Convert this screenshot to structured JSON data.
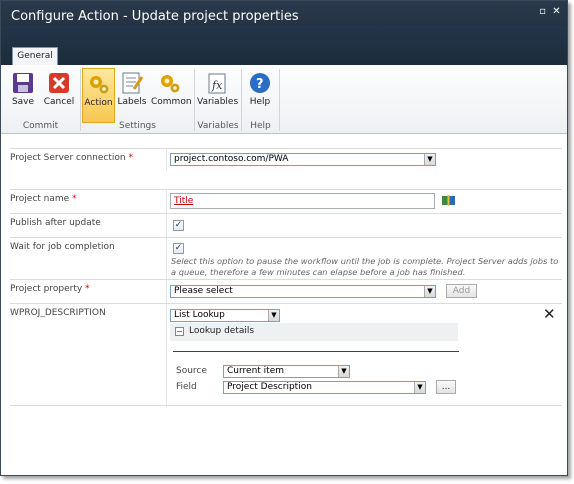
{
  "window": {
    "title": "Configure Action - Update project properties"
  },
  "ribbon": {
    "tab": "General",
    "buttons": {
      "save": "Save",
      "cancel": "Cancel",
      "action": "Action",
      "labels": "Labels",
      "common": "Common",
      "variables": "Variables",
      "help": "Help"
    },
    "groups": {
      "commit": "Commit",
      "settings": "Settings",
      "variables": "Variables",
      "help": "Help"
    }
  },
  "form": {
    "server_connection": {
      "label": "Project Server connection",
      "required_mark": "*",
      "value": "project.contoso.com/PWA"
    },
    "project_name": {
      "label": "Project name",
      "required_mark": "*",
      "value": "Title"
    },
    "publish_after_update": {
      "label": "Publish after update",
      "checked": true
    },
    "wait_for_job": {
      "label": "Wait for job completion",
      "checked": true,
      "help": "Select this option to pause the workflow until the job is complete. Project Server adds jobs to a queue, therefore a few minutes can elapse before a job has finished."
    },
    "project_property": {
      "label": "Project property",
      "required_mark": "*",
      "value": "Please select",
      "add_label": "Add"
    },
    "wproj_description": {
      "label": "WPROJ_DESCRIPTION",
      "lookup_type": "List Lookup",
      "lookup_details_label": "Lookup details",
      "source_label": "Source",
      "source_value": "Current item",
      "field_label": "Field",
      "field_value": "Project Description",
      "ellipsis_label": "..."
    }
  }
}
